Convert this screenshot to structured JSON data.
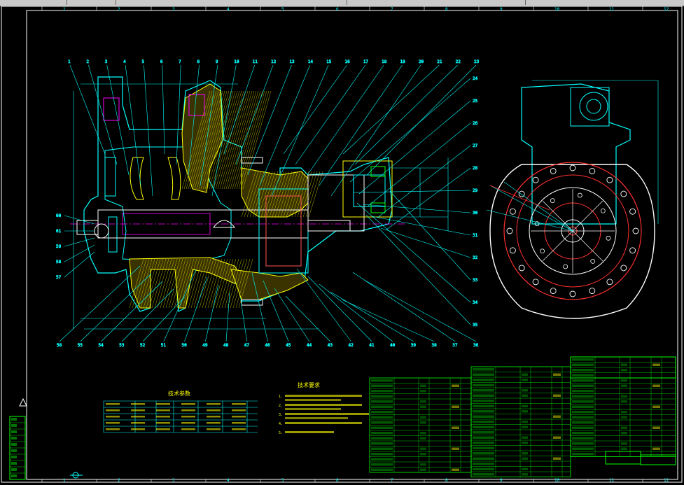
{
  "topbar": {
    "segments": 6
  },
  "grid_numbers": [
    "1",
    "2",
    "3",
    "4",
    "5",
    "6",
    "7",
    "8",
    "9",
    "10",
    "11",
    "12"
  ],
  "callouts_top": [
    "1",
    "2",
    "3",
    "4",
    "5",
    "6",
    "7",
    "8",
    "9",
    "10",
    "11",
    "12",
    "13",
    "14",
    "15",
    "16",
    "17",
    "18",
    "19",
    "20",
    "21",
    "22",
    "23"
  ],
  "callouts_right": [
    "24",
    "25",
    "26",
    "27",
    "28",
    "29",
    "30",
    "31",
    "32",
    "33",
    "34",
    "35"
  ],
  "callouts_bottom": [
    "58",
    "55",
    "54",
    "53",
    "52",
    "51",
    "50",
    "49",
    "48",
    "47",
    "46",
    "45",
    "44",
    "43",
    "42",
    "41",
    "40",
    "39",
    "38",
    "37",
    "36"
  ],
  "callouts_left": [
    "60",
    "61",
    "59",
    "58",
    "57"
  ],
  "tech_params": {
    "title": "技术参数"
  },
  "tech_requirements": {
    "title": "技术要求",
    "items": [
      "1.",
      "2.",
      "3.",
      "4.",
      "5."
    ]
  },
  "colors": {
    "outline": "#00ffff",
    "hatch": "#ffff00",
    "red": "#ff3030",
    "white": "#ffffff",
    "table": "#00ff00",
    "magenta": "#ff00ff"
  }
}
